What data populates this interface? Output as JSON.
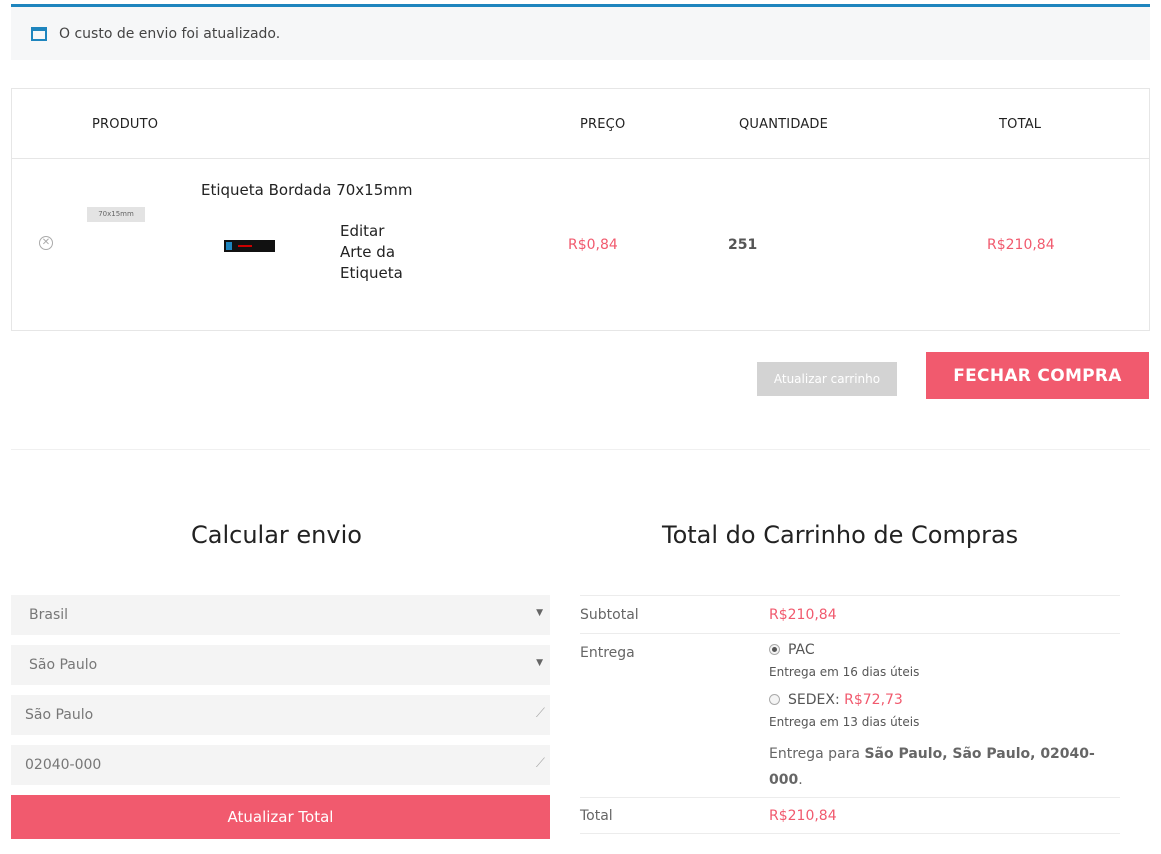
{
  "notice": {
    "text": "O custo de envio foi atualizado."
  },
  "cart": {
    "headers": {
      "product": "PRODUTO",
      "price": "PREÇO",
      "quantity": "QUANTIDADE",
      "total": "TOTAL"
    },
    "items": [
      {
        "thumb_label": "70x15mm",
        "name": "Etiqueta Bordada 70x15mm",
        "edit_label": "Editar Arte da Etiqueta",
        "price": "R$0,84",
        "quantity": "251",
        "total": "R$210,84"
      }
    ],
    "update_label": "Atualizar carrinho",
    "checkout_label": "FECHAR COMPRA"
  },
  "shipping_calc": {
    "title": "Calcular envio",
    "country": "Brasil",
    "state": "São Paulo",
    "city": "São Paulo",
    "postcode": "02040-000",
    "button_label": "Atualizar Total"
  },
  "totals": {
    "title": "Total do Carrinho de Compras",
    "subtotal_label": "Subtotal",
    "subtotal_value": "R$210,84",
    "delivery_label": "Entrega",
    "options": [
      {
        "name": "PAC",
        "price": "",
        "eta": "Entrega em 16 dias úteis",
        "selected": true
      },
      {
        "name": "SEDEX:",
        "price": "R$72,73",
        "eta": "Entrega em 13 dias úteis",
        "selected": false
      }
    ],
    "ship_to_prefix": "Entrega para",
    "ship_to_address": "São Paulo, São Paulo, 02040-000",
    "total_label": "Total",
    "total_value": "R$210,84"
  },
  "colors": {
    "accent": "#f15a6e",
    "notice_border": "#1e85be",
    "field_bg": "#f4f4f4"
  }
}
